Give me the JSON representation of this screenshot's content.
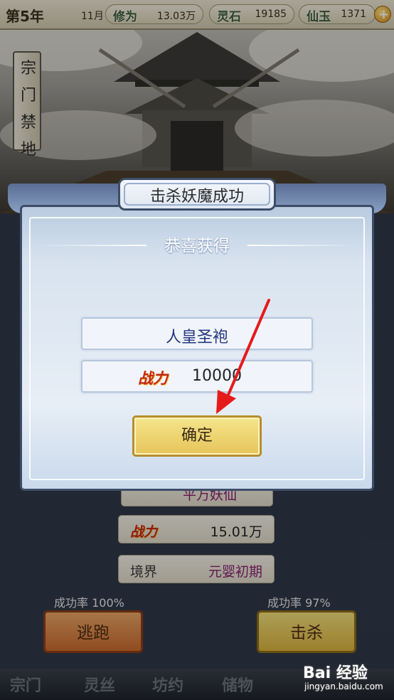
{
  "topbar": {
    "year": "第5年",
    "month": "11月",
    "stats": [
      {
        "label": "修为",
        "value": "13.03万"
      },
      {
        "label": "灵石",
        "value": "19185"
      },
      {
        "label": "仙玉",
        "value": "1371"
      }
    ],
    "plus": "+"
  },
  "side_banner": [
    "宗",
    "门",
    "禁",
    "地"
  ],
  "enemy": {
    "name": "平万妖仙",
    "power_label": "战力",
    "power_value": "15.01万",
    "realm_label": "境界",
    "realm_value": "元婴初期"
  },
  "actions": {
    "flee_rate": "成功率 100%",
    "flee_label": "逃跑",
    "kill_rate": "成功率 97%",
    "kill_label": "击杀"
  },
  "bottom_nav": [
    "宗门",
    "灵丝",
    "坊约",
    "储物"
  ],
  "dialog": {
    "title": "击杀妖魔成功",
    "subtitle": "恭喜获得",
    "item_name": "人皇圣袍",
    "power_label": "战力",
    "power_value": "10000",
    "confirm_label": "确定"
  },
  "watermark": {
    "brand": "Bai 经验",
    "url": "jingyan.baidu.com"
  },
  "colors": {
    "accent_red": "#c4261a",
    "realm_purple": "#8a1f6e",
    "item_blue": "#24367e",
    "arrow_red": "#e51b1b"
  }
}
